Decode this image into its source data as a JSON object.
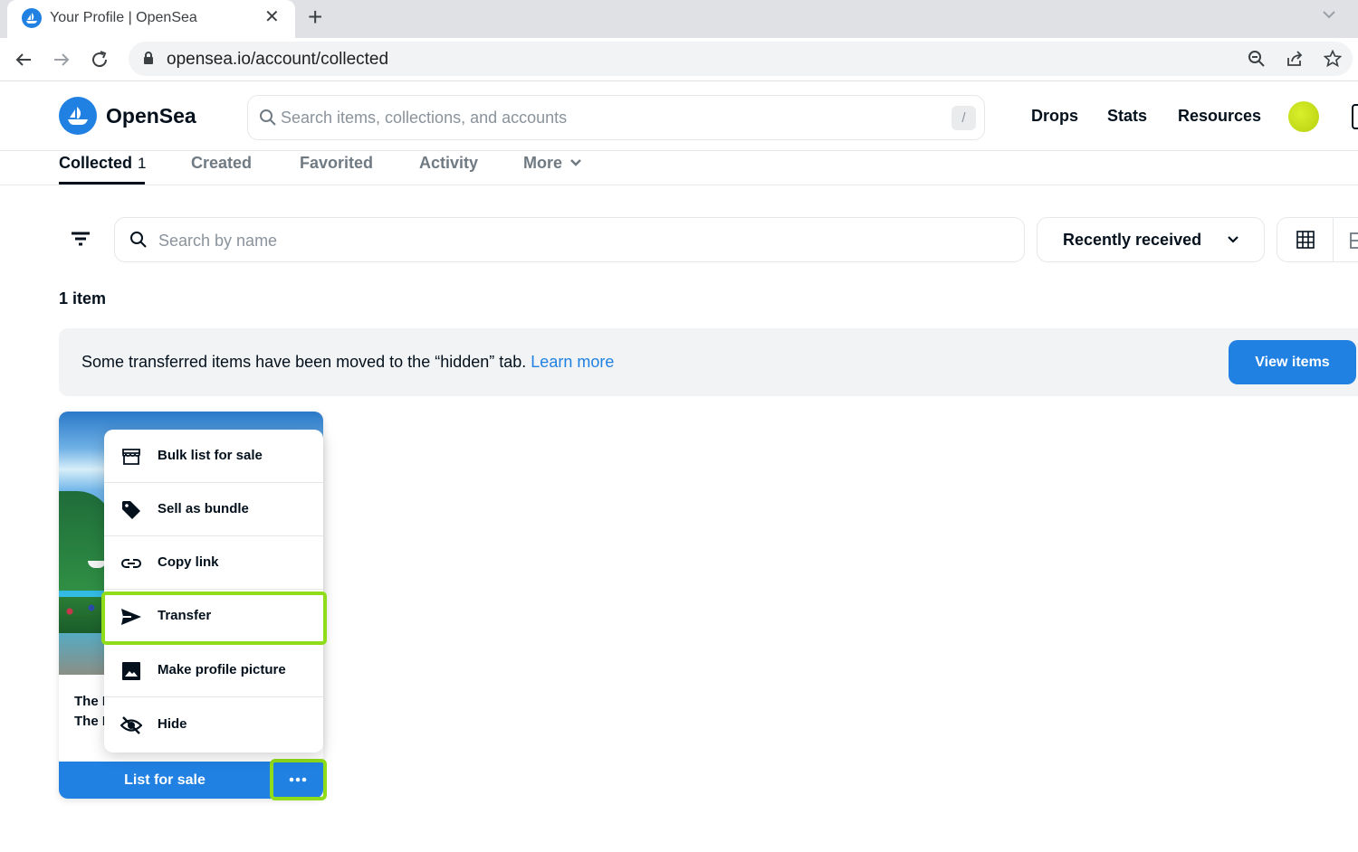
{
  "browser": {
    "tab_title": "Your Profile | OpenSea",
    "tab_close": "✕",
    "new_tab": "+",
    "url": "opensea.io/account/collected"
  },
  "header": {
    "logo_text": "OpenSea",
    "search_placeholder": "Search items, collections, and accounts",
    "search_shortcut": "/",
    "nav": [
      "Drops",
      "Stats",
      "Resources"
    ],
    "avatar_color": "#c5e01a"
  },
  "profile_tabs": {
    "collected_label": "Collected",
    "collected_count": "1",
    "created_label": "Created",
    "favorited_label": "Favorited",
    "activity_label": "Activity",
    "more_label": "More"
  },
  "toolbar": {
    "name_search_placeholder": "Search by name",
    "sort_label": "Recently received"
  },
  "item_count": "1 item",
  "notice": {
    "text": "Some transferred items have been moved to the “hidden” tab.",
    "link": "Learn more",
    "button": "View items"
  },
  "card": {
    "name_line1": "The I",
    "name_line2": "The I",
    "list_button": "List for sale",
    "more_icon": "ellipsis-icon"
  },
  "menu": {
    "items": [
      {
        "label": "Bulk list for sale",
        "icon": "storefront-icon"
      },
      {
        "label": "Sell as bundle",
        "icon": "tag-icon"
      },
      {
        "label": "Copy link",
        "icon": "link-icon"
      },
      {
        "label": "Transfer",
        "icon": "send-icon"
      },
      {
        "label": "Make profile picture",
        "icon": "image-icon"
      },
      {
        "label": "Hide",
        "icon": "eye-off-icon"
      }
    ]
  },
  "colors": {
    "brand_blue": "#2081e2",
    "highlight": "#8fdc1b",
    "text_dark": "#04111d",
    "text_muted": "#707a83"
  }
}
